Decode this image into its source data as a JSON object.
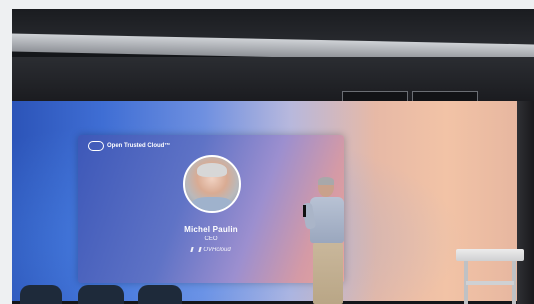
{
  "slide": {
    "brand": "Open Trusted Cloud",
    "brand_mark": "™",
    "speaker_name": "Michel Paulin",
    "speaker_role": "CEO",
    "company": "OVHcloud"
  },
  "colors": {
    "screen_left": "#2c54b8",
    "screen_right": "#f2c3a6",
    "card_text": "#ffffff"
  }
}
